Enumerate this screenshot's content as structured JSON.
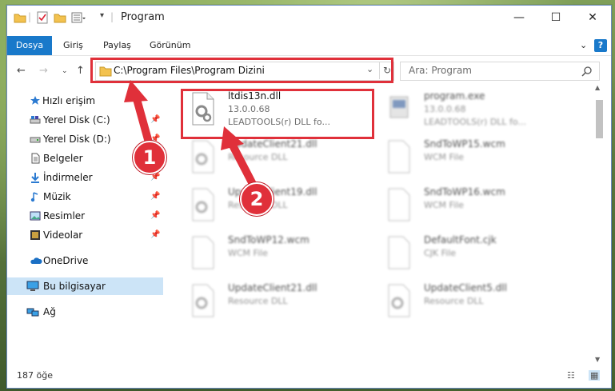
{
  "window": {
    "title": "Program"
  },
  "ribbon": {
    "tabs": [
      "Dosya",
      "Giriş",
      "Paylaş",
      "Görünüm"
    ],
    "active": "Dosya"
  },
  "address": {
    "path": "C:\\Program Files\\Program Dizini"
  },
  "search": {
    "placeholder": "Ara: Program"
  },
  "sidebar": {
    "items": [
      {
        "label": "Hızlı erişim",
        "icon": "star-icon"
      },
      {
        "label": "Yerel Disk (C:)",
        "icon": "drive-icon",
        "pinned": true
      },
      {
        "label": "Yerel Disk (D:)",
        "icon": "drive-icon",
        "pinned": true
      },
      {
        "label": "Belgeler",
        "icon": "document-icon",
        "pinned": true
      },
      {
        "label": "İndirmeler",
        "icon": "download-icon",
        "pinned": true
      },
      {
        "label": "Müzik",
        "icon": "music-icon",
        "pinned": true
      },
      {
        "label": "Resimler",
        "icon": "pictures-icon",
        "pinned": true
      },
      {
        "label": "Videolar",
        "icon": "video-icon",
        "pinned": true
      },
      {
        "label": "OneDrive",
        "icon": "cloud-icon"
      },
      {
        "label": "Bu bilgisayar",
        "icon": "computer-icon",
        "selected": true
      },
      {
        "label": "Ağ",
        "icon": "network-icon"
      }
    ]
  },
  "files": [
    {
      "name": "ltdis13n.dll",
      "line1": "13.0.0.68",
      "line2": "LEADTOOLS(r) DLL fo...",
      "icon": "dll-icon",
      "highlighted": true
    },
    {
      "name": "program.exe",
      "line1": "13.0.0.68",
      "line2": "LEADTOOLS(r) DLL fo...",
      "icon": "exe-icon"
    },
    {
      "name": "UpdateClient21.dll",
      "line1": "Resource DLL",
      "icon": "dll-icon"
    },
    {
      "name": "SndToWP15.wcm",
      "line1": "WCM File",
      "icon": "file-icon"
    },
    {
      "name": "UpdateClient19.dll",
      "line1": "Resource DLL",
      "icon": "dll-icon"
    },
    {
      "name": "SndToWP16.wcm",
      "line1": "WCM File",
      "icon": "file-icon"
    },
    {
      "name": "SndToWP12.wcm",
      "line1": "WCM File",
      "icon": "file-icon"
    },
    {
      "name": "DefaultFont.cjk",
      "line1": "CJK File",
      "icon": "file-icon"
    },
    {
      "name": "UpdateClient21.dll",
      "line1": "Resource DLL",
      "icon": "dll-icon"
    },
    {
      "name": "UpdateClient5.dll",
      "line1": "Resource DLL",
      "icon": "dll-icon"
    }
  ],
  "status": {
    "count": "187 öğe"
  },
  "callouts": [
    "1",
    "2"
  ],
  "colors": {
    "accent": "#1979ca",
    "highlight": "#e0303a",
    "selected": "#cce4f7"
  }
}
